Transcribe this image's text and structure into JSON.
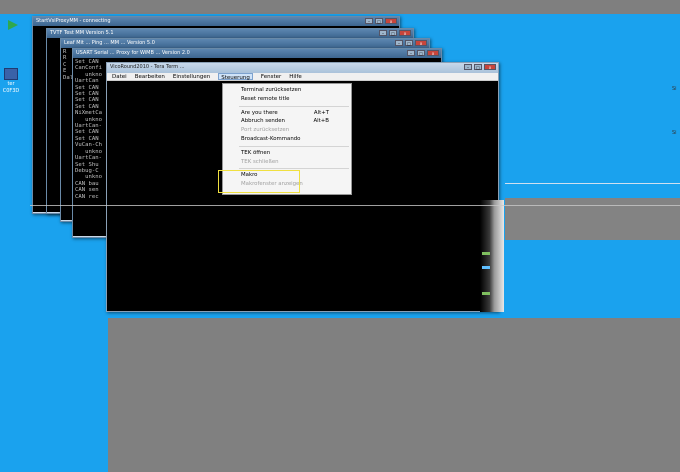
{
  "desktop_icons": [
    {
      "name": "icon-1",
      "label": ""
    },
    {
      "name": "icon-2",
      "label": "ter"
    },
    {
      "name": "icon-3",
      "label": "C0F3D"
    }
  ],
  "windows": {
    "w1": {
      "title": "StartVsiProxyMM - connecting"
    },
    "w2": {
      "title": "TVTF Test MM Version 5.1"
    },
    "w3": {
      "title": "Leaf Mit ... Ping ... MM ... Version 5.0"
    },
    "w4": {
      "title": "USART Serial ... Proxy for WiMB ... Version 2.0"
    },
    "w5": {
      "title": "VicoRound2010 - Tera Term ..."
    }
  },
  "console_lines_w4": [
    "Set CAN",
    "CanConfi",
    "   unkno",
    "UartCan",
    "Set CAN",
    "Set CAN",
    "Set CAN",
    "Set CAN",
    "NiXmetCa",
    "   unkno",
    "UartCan-",
    "Set CAN",
    "Set CAN",
    "VuCan-Ch",
    "   unkno",
    "UartCan-",
    "Set Shu",
    "Debug-C",
    "   unkno",
    "CAN bau",
    "CAN sen",
    "CAN rec"
  ],
  "console_prefix_w3": [
    "R",
    "R",
    "C",
    "E",
    "",
    "",
    "",
    "",
    "",
    "",
    "",
    "",
    "",
    "",
    "",
    "",
    "",
    "",
    "Dal"
  ],
  "menubar": [
    {
      "key": "file",
      "label": "Datei"
    },
    {
      "key": "edit",
      "label": "Bearbeiten"
    },
    {
      "key": "setup",
      "label": "Einstellungen"
    },
    {
      "key": "control",
      "label": "Steuerung"
    },
    {
      "key": "window",
      "label": "Fenster"
    },
    {
      "key": "help",
      "label": "Hilfe"
    }
  ],
  "menu_items": [
    {
      "label": "Terminal zurücksetzen",
      "shortcut": "",
      "disabled": false
    },
    {
      "label": "Reset remote title",
      "shortcut": "",
      "disabled": false
    },
    {
      "sep": true
    },
    {
      "label": "Are you there",
      "shortcut": "Alt+T",
      "disabled": false
    },
    {
      "label": "Abbruch senden",
      "shortcut": "Alt+B",
      "disabled": false
    },
    {
      "label": "Port zurücksetzen",
      "shortcut": "",
      "disabled": true
    },
    {
      "label": "Broadcast-Kommando",
      "shortcut": "",
      "disabled": false
    },
    {
      "sep": true
    },
    {
      "label": "TEK öffnen",
      "shortcut": "",
      "disabled": false
    },
    {
      "label": "TEK schließen",
      "shortcut": "",
      "disabled": true
    },
    {
      "sep": true
    },
    {
      "label": "Makro",
      "shortcut": "",
      "disabled": false
    },
    {
      "label": "Makrofenster anzeigen",
      "shortcut": "",
      "disabled": true
    }
  ],
  "title_buttons": {
    "min": "–",
    "max": "□",
    "close": "x"
  },
  "right_edge_text": [
    "Si",
    "Si"
  ]
}
